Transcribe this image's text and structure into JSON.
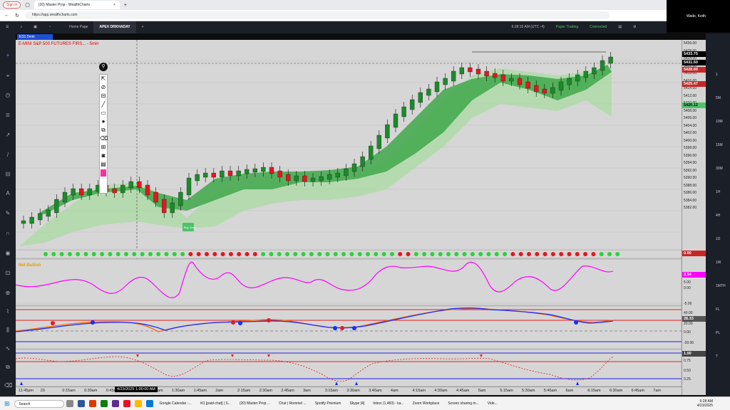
{
  "browser": {
    "sign_in": "Sign in",
    "tab_title": "(20) Master Prop - WealthCharts",
    "url": "https://app.wealthcharts.com"
  },
  "video": {
    "name": "Wade, Keith"
  },
  "app": {
    "tabs": [
      "Home Page",
      "APEX DRKHADAY"
    ],
    "time": "6:28:16 AM (UTC -4)",
    "paper_trading": "Paper Trading",
    "connected": "Connected",
    "symbol": "ES1 5min",
    "chart_title": "E-MINI S&P 500 FUTURES FIRS... - 5min"
  },
  "price_axis": {
    "labels": [
      "5436.00",
      "5428.00",
      "5424.00",
      "5422.00",
      "5418.00",
      "5416.00",
      "5414.00",
      "5412.00",
      "5410.00",
      "5408.00",
      "5406.00",
      "5404.00",
      "5402.00",
      "5400.00",
      "5398.00",
      "5396.00",
      "5394.00",
      "5392.00",
      "5390.00",
      "5388.00",
      "5386.00",
      "5384.00",
      "5382.00"
    ],
    "tag_last": "5433.75",
    "tag_current": "5431.50",
    "tag_red1": "5428.00",
    "tag_red2": "5425.47",
    "tag_green": "5420.12"
  },
  "right_rail": [
    "1",
    "5M",
    "10M",
    "15M",
    "30M",
    "1H",
    "4H",
    "1D",
    "1W",
    "1MTH",
    "FL",
    "PL",
    "T"
  ],
  "indicators": {
    "dots_value": "0.00",
    "osc_label": "Net Bullish",
    "osc_value": "3.54",
    "osc_levels": [
      "5.00",
      "0.00",
      "-5.00"
    ],
    "line_value": "28.33",
    "line_levels": [
      "40.00",
      "20.00",
      "0.00",
      "-20.00"
    ],
    "bottom_value": "1.00",
    "bottom_levels": [
      "0.75",
      "0.50",
      "0.25"
    ]
  },
  "time_axis": {
    "labels": [
      "11:45pm",
      "23",
      "0:15am",
      "0:30am",
      "0:45am",
      "1am",
      "1:15am",
      "1:30am",
      "1:45am",
      "2am",
      "2:15am",
      "2:30am",
      "2:45am",
      "3am",
      "3:15am",
      "3:30am",
      "3:45am",
      "4am",
      "4:15am",
      "4:30am",
      "4:45am",
      "5am",
      "5:15am",
      "5:30am",
      "5:45am",
      "6am",
      "6:15am",
      "6:30am",
      "6:45am",
      "7am"
    ],
    "crosshair": "4/23/2025 1:00:00 AM"
  },
  "buy_label": "Buy Zone",
  "taskbar": {
    "search": "Search",
    "items": [
      "Google Calendar -...",
      "#I1 [paid-chat] | S...",
      "(20) Master Prop ...",
      "Chat | Rommel ...",
      "Spotify Premium",
      "Skype [4]",
      "Inbox (1,483) - ka...",
      "Zoom Workplace",
      "Screen sharing m...",
      "Vide..."
    ],
    "time": "6:28 AM",
    "date": "4/23/2025"
  }
}
